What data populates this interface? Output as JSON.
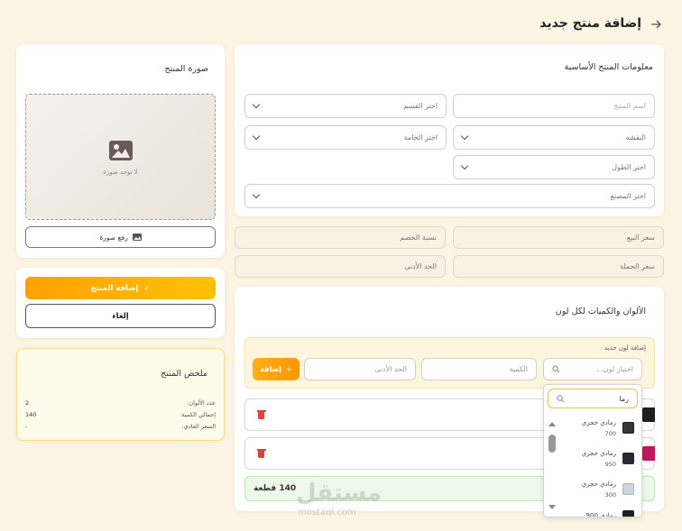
{
  "header": {
    "title": "إضافة منتج جديد",
    "back_icon": "arrow-right-icon"
  },
  "basic_info": {
    "title": "معلومات المنتج الأساسية",
    "name_placeholder": "اسم المنتج",
    "category": "اختر القسم",
    "pattern": "النقشه",
    "material": "اختر الخامة",
    "length": "اختر الطول",
    "factory": "اختر المصنع"
  },
  "pricing": {
    "sale_price": "سعر البيع",
    "discount": "نسبة الخصم",
    "wholesale_price": "سعر الجملة",
    "minimum": "الحد الأدنى"
  },
  "colors": {
    "title": "الألوان والكميات لكل لون",
    "add_label": "إضافة لون جديد",
    "color_placeholder": "اختيار لون...",
    "quantity_placeholder": "الكمية",
    "minimum_placeholder": "الحد الأدنى",
    "add_button": "إضافة",
    "total": "140 قطعة"
  },
  "dropdown": {
    "search_value": "رما",
    "options": [
      {
        "name": "رمادي حجري",
        "code": "700",
        "color": "#3a3636"
      },
      {
        "name": "رمادي حجري",
        "code": "950",
        "color": "#262a33"
      },
      {
        "name": "رمادي حجري",
        "code": "300",
        "color": "#c9d6dc"
      },
      {
        "name": "رمادي 900",
        "code": "",
        "color": "#1e1e22"
      }
    ]
  },
  "image": {
    "title": "صورة المنتج",
    "empty": "لا توجد صورة",
    "upload_button": "رفع صورة"
  },
  "actions": {
    "submit": "إضافة المنتج",
    "cancel": "إلغاء"
  },
  "summary": {
    "title": "ملخص المنتج",
    "rows": [
      {
        "label": "عدد الألوان:",
        "value": "2"
      },
      {
        "label": "إجمالي الكمية:",
        "value": "140"
      },
      {
        "label": "السعر العادي:",
        "value": "-"
      }
    ]
  },
  "watermark": {
    "arabic": "مستقل",
    "latin": "mostaql.com"
  }
}
